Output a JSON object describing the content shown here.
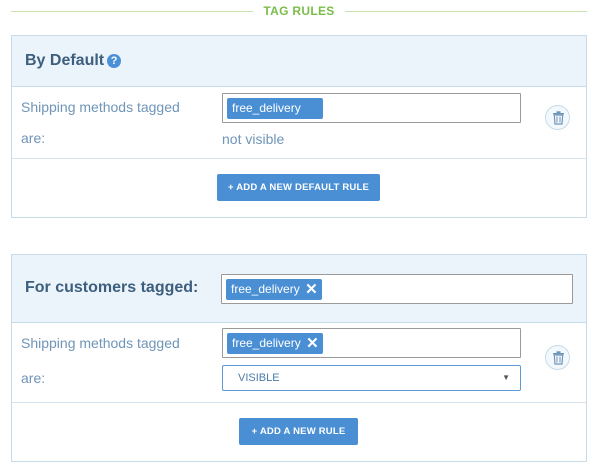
{
  "section_title": "TAG RULES",
  "default_panel": {
    "heading": "By Default",
    "help_icon": "question-circle-icon",
    "rule": {
      "label_line1": "Shipping methods tagged",
      "label_line2": "are:",
      "tag": "free_delivery",
      "remove_glyph": "✕",
      "visibility": "not visible"
    },
    "add_button": "+ ADD A NEW DEFAULT RULE"
  },
  "customer_panel": {
    "heading": "For customers tagged:",
    "customer_tag": "free_delivery",
    "remove_glyph": "✕",
    "rule": {
      "label_line1": "Shipping methods tagged",
      "label_line2": "are:",
      "tag": "free_delivery",
      "visibility_selected": "VISIBLE",
      "chevron": "▼"
    },
    "add_button": "+ ADD A NEW RULE"
  },
  "colors": {
    "accent": "#4a8fd4",
    "section_title": "#7bbd4a",
    "panel_header_bg": "#ebf3fb",
    "label_text": "#6f95b8"
  }
}
